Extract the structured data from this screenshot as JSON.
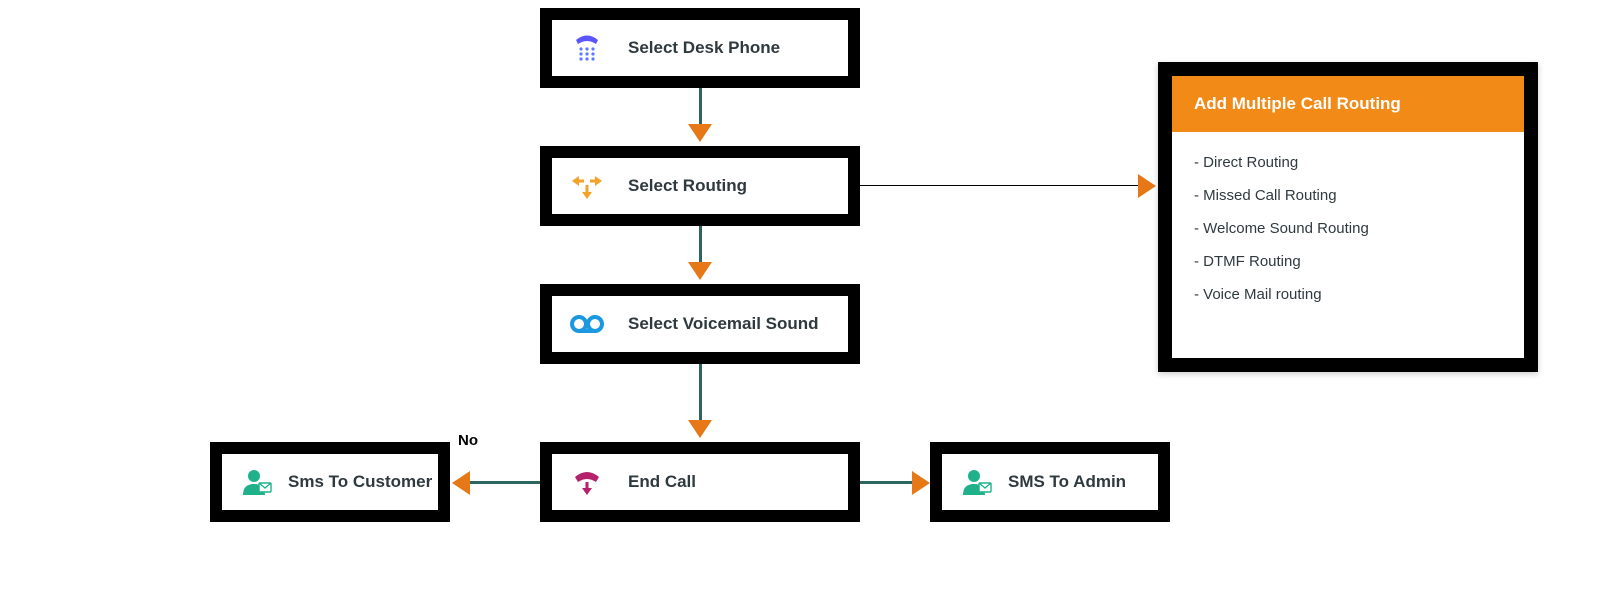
{
  "steps": {
    "desk": {
      "label": "Select Desk Phone",
      "icon": "desk-phone-icon"
    },
    "routing": {
      "label": "Select Routing",
      "icon": "routing-icon"
    },
    "voicemail": {
      "label": "Select Voicemail Sound",
      "icon": "voicemail-icon"
    },
    "end": {
      "label": "End Call",
      "icon": "end-call-icon"
    },
    "sms_cust": {
      "label": "Sms To Customer",
      "icon": "person-mail-icon"
    },
    "sms_admin": {
      "label": "SMS To Admin",
      "icon": "person-mail-icon"
    }
  },
  "edge_labels": {
    "end_to_customer": "No"
  },
  "panel": {
    "title": "Add Multiple Call Routing",
    "items": [
      "- Direct Routing",
      "- Missed Call Routing",
      "- Welcome Sound Routing",
      "- DTMF Routing",
      "- Voice Mail routing"
    ]
  },
  "colors": {
    "border": "#000000",
    "arrow": "#e77817",
    "line": "#2d665f",
    "panel_head": "#f28a17",
    "icon_phone": "#5a55ff",
    "icon_routing": "#f3a22a",
    "icon_voicemail": "#1b98e0",
    "icon_end": "#b5216b",
    "icon_person": "#1fb28a"
  }
}
